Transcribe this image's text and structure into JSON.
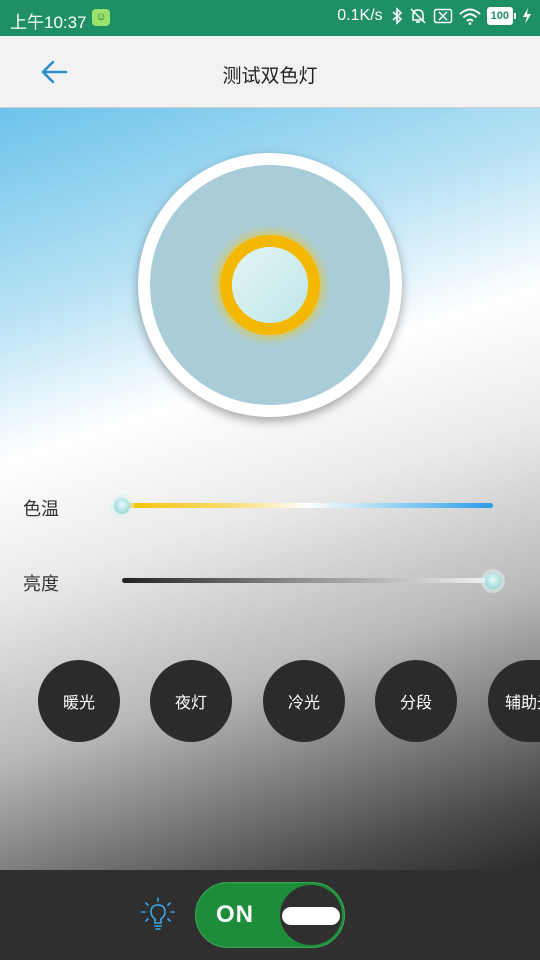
{
  "status_bar": {
    "time": "上午10:37",
    "net_speed": "0.1K/s",
    "battery": "100"
  },
  "app_bar": {
    "title": "测试双色灯"
  },
  "sliders": {
    "color_temp": {
      "label": "色温",
      "value": 0
    },
    "brightness": {
      "label": "亮度",
      "value": 1
    }
  },
  "modes": [
    {
      "label": "暖光",
      "active": true
    },
    {
      "label": "夜灯",
      "active": false
    },
    {
      "label": "冷光",
      "active": false
    },
    {
      "label": "分段",
      "active": false
    },
    {
      "label": "辅助光",
      "active": false
    }
  ],
  "power": {
    "state_label": "ON",
    "on": true
  },
  "colors": {
    "status_bar": "#1f8f66",
    "active_mode": "#29b3f3",
    "toggle_on": "#1d8d3a",
    "ring": "#f5b800",
    "back_arrow": "#2a8fd0"
  },
  "icons": {
    "back": "arrow-left-icon",
    "bulb": "lightbulb-icon",
    "bluetooth": "bluetooth-icon",
    "mute": "bell-off-icon",
    "no_sim": "sim-off-icon",
    "wifi": "wifi-icon",
    "charging": "bolt-icon"
  }
}
